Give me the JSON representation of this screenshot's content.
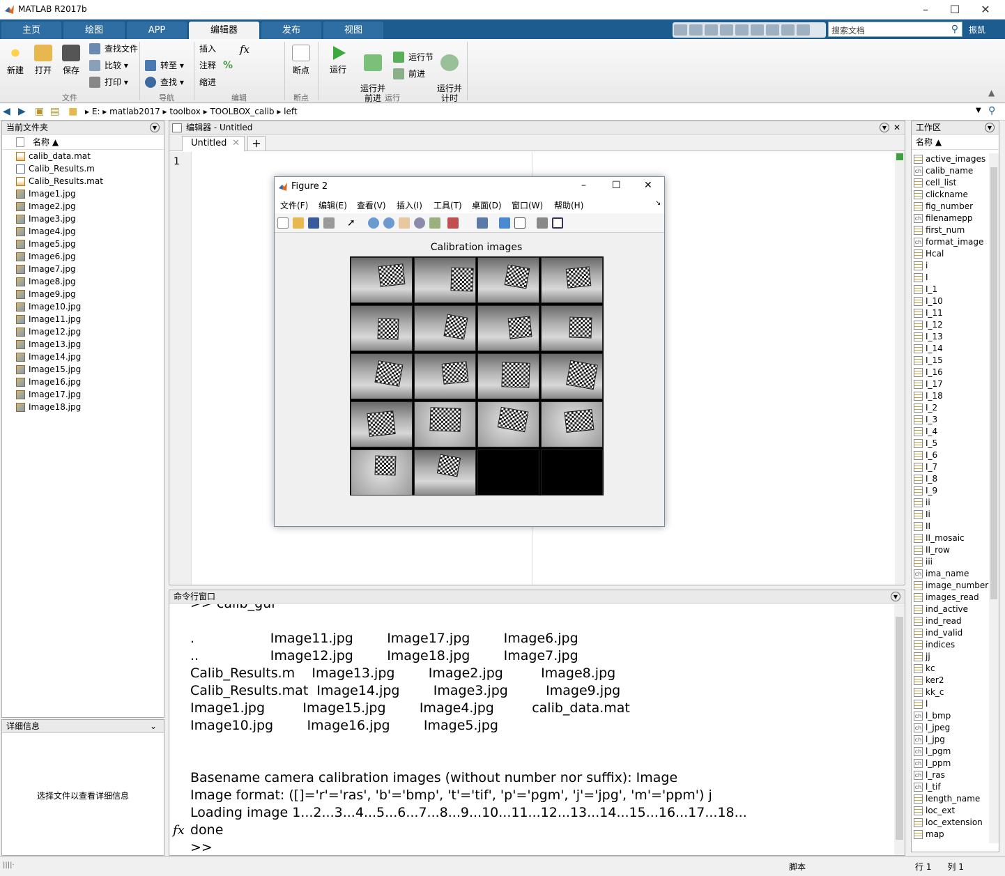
{
  "app": {
    "title": "MATLAB R2017b"
  },
  "tabs": [
    "主页",
    "绘图",
    "APP",
    "编辑器",
    "发布",
    "视图"
  ],
  "search": {
    "placeholder": "搜索文档"
  },
  "user": "振凯",
  "ribbon": {
    "new": "新建",
    "open": "打开",
    "save": "保存",
    "find_files": "查找文件",
    "compare": "比较",
    "print": "打印",
    "goto": "转至",
    "find": "查找",
    "insert": "插入",
    "comment": "注释",
    "indent": "缩进",
    "breakpoints": "断点",
    "run": "运行",
    "run_advance": "运行并\n前进",
    "run_section": "运行节",
    "advance": "前进",
    "run_time": "运行并\n计时",
    "groups": {
      "file": "文件",
      "nav": "导航",
      "edit": "编辑",
      "breakpoints": "断点",
      "run": "运行"
    }
  },
  "address": {
    "crumbs": [
      "E:",
      "matlab2017",
      "toolbox",
      "TOOLBOX_calib",
      "left"
    ]
  },
  "current_folder": {
    "title": "当前文件夹",
    "col_name": "名称 ▲",
    "files": [
      {
        "name": "calib_data.mat",
        "type": "mat"
      },
      {
        "name": "Calib_Results.m",
        "type": "m"
      },
      {
        "name": "Calib_Results.mat",
        "type": "mat"
      },
      {
        "name": "Image1.jpg",
        "type": "jpg"
      },
      {
        "name": "Image2.jpg",
        "type": "jpg"
      },
      {
        "name": "Image3.jpg",
        "type": "jpg"
      },
      {
        "name": "Image4.jpg",
        "type": "jpg"
      },
      {
        "name": "Image5.jpg",
        "type": "jpg"
      },
      {
        "name": "Image6.jpg",
        "type": "jpg"
      },
      {
        "name": "Image7.jpg",
        "type": "jpg"
      },
      {
        "name": "Image8.jpg",
        "type": "jpg"
      },
      {
        "name": "Image9.jpg",
        "type": "jpg"
      },
      {
        "name": "Image10.jpg",
        "type": "jpg"
      },
      {
        "name": "Image11.jpg",
        "type": "jpg"
      },
      {
        "name": "Image12.jpg",
        "type": "jpg"
      },
      {
        "name": "Image13.jpg",
        "type": "jpg"
      },
      {
        "name": "Image14.jpg",
        "type": "jpg"
      },
      {
        "name": "Image15.jpg",
        "type": "jpg"
      },
      {
        "name": "Image16.jpg",
        "type": "jpg"
      },
      {
        "name": "Image17.jpg",
        "type": "jpg"
      },
      {
        "name": "Image18.jpg",
        "type": "jpg"
      }
    ]
  },
  "details": {
    "title": "详细信息",
    "message": "选择文件以查看详细信息"
  },
  "editor": {
    "title": "编辑器 - Untitled",
    "tab": "Untitled",
    "line": "1"
  },
  "figure": {
    "title": "Figure 2",
    "menu": [
      "文件(F)",
      "编辑(E)",
      "查看(V)",
      "插入(I)",
      "工具(T)",
      "桌面(D)",
      "窗口(W)",
      "帮助(H)"
    ],
    "axes_title": "Calibration images"
  },
  "command_window": {
    "title": "命令行窗口",
    "lines": [
      ">> calib_gui",
      "",
      ".                  Image11.jpg        Image17.jpg        Image6.jpg",
      "..                 Image12.jpg        Image18.jpg        Image7.jpg",
      "Calib_Results.m    Image13.jpg        Image2.jpg         Image8.jpg",
      "Calib_Results.mat  Image14.jpg        Image3.jpg         Image9.jpg",
      "Image1.jpg         Image15.jpg        Image4.jpg         calib_data.mat",
      "Image10.jpg        Image16.jpg        Image5.jpg",
      "",
      "",
      "Basename camera calibration images (without number nor suffix): Image",
      "Image format: ([]='r'='ras', 'b'='bmp', 't'='tif', 'p'='pgm', 'j'='jpg', 'm'='ppm') j",
      "Loading image 1...2...3...4...5...6...7...8...9...10...11...12...13...14...15...16...17...18...",
      "done",
      ">>"
    ],
    "prompt_icon": "fx"
  },
  "workspace": {
    "title": "工作区",
    "col_name": "名称 ▲",
    "vars": [
      "active_images",
      "calib_name",
      "cell_list",
      "clickname",
      "fig_number",
      "filenamepp",
      "first_num",
      "format_image",
      "Hcal",
      "i",
      "I",
      "I_1",
      "I_10",
      "I_11",
      "I_12",
      "I_13",
      "I_14",
      "I_15",
      "I_16",
      "I_17",
      "I_18",
      "I_2",
      "I_3",
      "I_4",
      "I_5",
      "I_6",
      "I_7",
      "I_8",
      "I_9",
      "ii",
      "Ii",
      "II",
      "II_mosaic",
      "II_row",
      "iii",
      "ima_name",
      "image_numbers",
      "images_read",
      "ind_active",
      "ind_read",
      "ind_valid",
      "indices",
      "jj",
      "kc",
      "ker2",
      "kk_c",
      "l",
      "l_bmp",
      "l_jpeg",
      "l_jpg",
      "l_pgm",
      "l_ppm",
      "l_ras",
      "l_tif",
      "length_name",
      "loc_ext",
      "loc_extension",
      "map"
    ],
    "char_vars": [
      "calib_name",
      "filenamepp",
      "format_image",
      "ima_name",
      "l_bmp",
      "l_jpeg",
      "l_jpg",
      "l_pgm",
      "l_ppm",
      "l_ras",
      "l_tif"
    ]
  },
  "status": {
    "mode": "脚本",
    "row_label": "行",
    "row": "1",
    "col_label": "列",
    "col": "1"
  },
  "colors": {
    "tabstrip": "#1d5c8e",
    "tab": "#2f6ea3",
    "accent": "#1d5c8e"
  }
}
